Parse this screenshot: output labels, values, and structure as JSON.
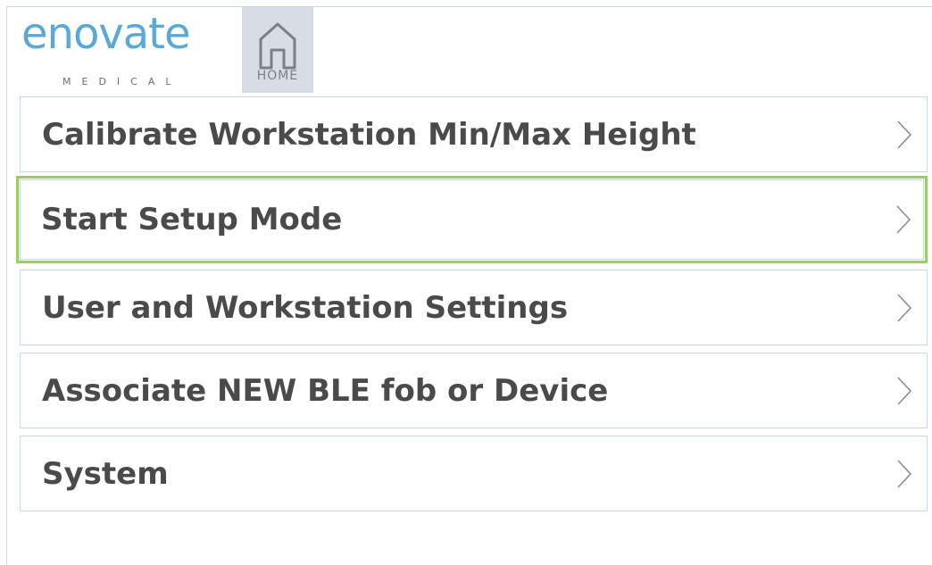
{
  "brand": {
    "name": "enovate",
    "subtitle": "MEDICAL",
    "color": "#5aa8d8"
  },
  "home": {
    "label": "HOME",
    "icon": "home-icon"
  },
  "menu": {
    "selected_color": "#9ccc6a",
    "items": [
      {
        "label": "Calibrate Workstation Min/Max Height",
        "icon": "chevron-right-icon",
        "selected": false
      },
      {
        "label": "Start Setup Mode",
        "icon": "chevron-right-icon",
        "selected": true
      },
      {
        "label": "User and Workstation Settings",
        "icon": "chevron-right-icon",
        "selected": false
      },
      {
        "label": "Associate NEW BLE fob or Device",
        "icon": "chevron-right-icon",
        "selected": false
      },
      {
        "label": "System",
        "icon": "chevron-right-icon",
        "selected": false
      }
    ]
  }
}
